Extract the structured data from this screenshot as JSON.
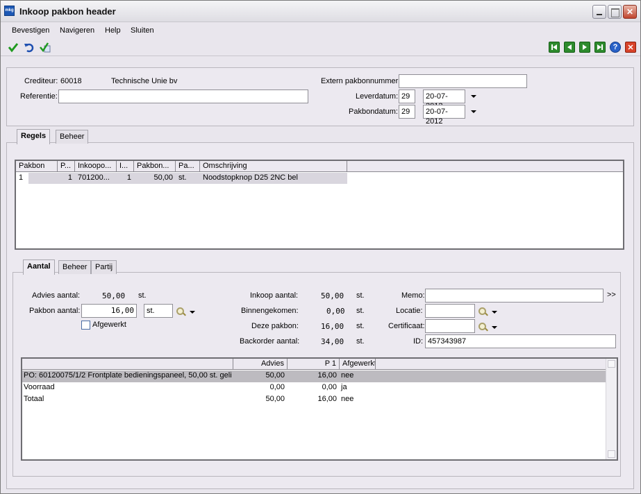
{
  "window": {
    "title": "Inkoop pakbon header",
    "icon_text": "mkg"
  },
  "menu": [
    "Bevestigen",
    "Navigeren",
    "Help",
    "Sluiten"
  ],
  "header": {
    "crediteur_label": "Crediteur:",
    "crediteur_code": "60018",
    "crediteur_name": "Technische Unie bv",
    "referentie_label": "Referentie:",
    "referentie_value": "",
    "extern_label": "Extern pakbonnummer:",
    "extern_value": "",
    "leverdatum_label": "Leverdatum:",
    "leverdatum_week": "29",
    "leverdatum_date": "20-07-2012",
    "pakbondatum_label": "Pakbondatum:",
    "pakbondatum_week": "29",
    "pakbondatum_date": "20-07-2012"
  },
  "top_tabs": [
    "Regels",
    "Beheer"
  ],
  "lines_grid": {
    "columns": [
      "Pakbon",
      "P...",
      "Inkoopo...",
      "I...",
      "Pakbon...",
      "Pa...",
      "Omschrijving"
    ],
    "rows": [
      [
        "1",
        "1",
        "701200...",
        "1",
        "50,00",
        "st.",
        "Noodstopknop D25 2NC bel"
      ]
    ]
  },
  "bottom_tabs": [
    "Aantal",
    "Beheer",
    "Partij"
  ],
  "aantal": {
    "advies_label": "Advies aantal:",
    "advies_value": "50,00",
    "advies_unit": "st.",
    "pakbon_label": "Pakbon aantal:",
    "pakbon_value": "16,00",
    "pakbon_unit": "st.",
    "afgewerkt_label": "Afgewerkt",
    "inkoop_label": "Inkoop aantal:",
    "inkoop_value": "50,00",
    "inkoop_unit": "st.",
    "binnen_label": "Binnengekomen:",
    "binnen_value": "0,00",
    "binnen_unit": "st.",
    "deze_label": "Deze pakbon:",
    "deze_value": "16,00",
    "deze_unit": "st.",
    "backorder_label": "Backorder aantal:",
    "backorder_value": "34,00",
    "backorder_unit": "st.",
    "memo_label": "Memo:",
    "memo_value": "",
    "memo_more": ">>",
    "locatie_label": "Locatie:",
    "certificaat_label": "Certificaat:",
    "id_label": "ID:",
    "id_value": "457343987"
  },
  "summary_grid": {
    "columns": [
      "",
      "Advies",
      "P 1",
      "Afgewerkt"
    ],
    "rows": [
      [
        "PO: 60120075/1/2 Frontplate bedieningspaneel, 50,00 st. geli",
        "50,00",
        "16,00",
        "nee"
      ],
      [
        "Voorraad",
        "0,00",
        "0,00",
        "ja"
      ],
      [
        "Totaal",
        "50,00",
        "16,00",
        "nee"
      ]
    ]
  }
}
